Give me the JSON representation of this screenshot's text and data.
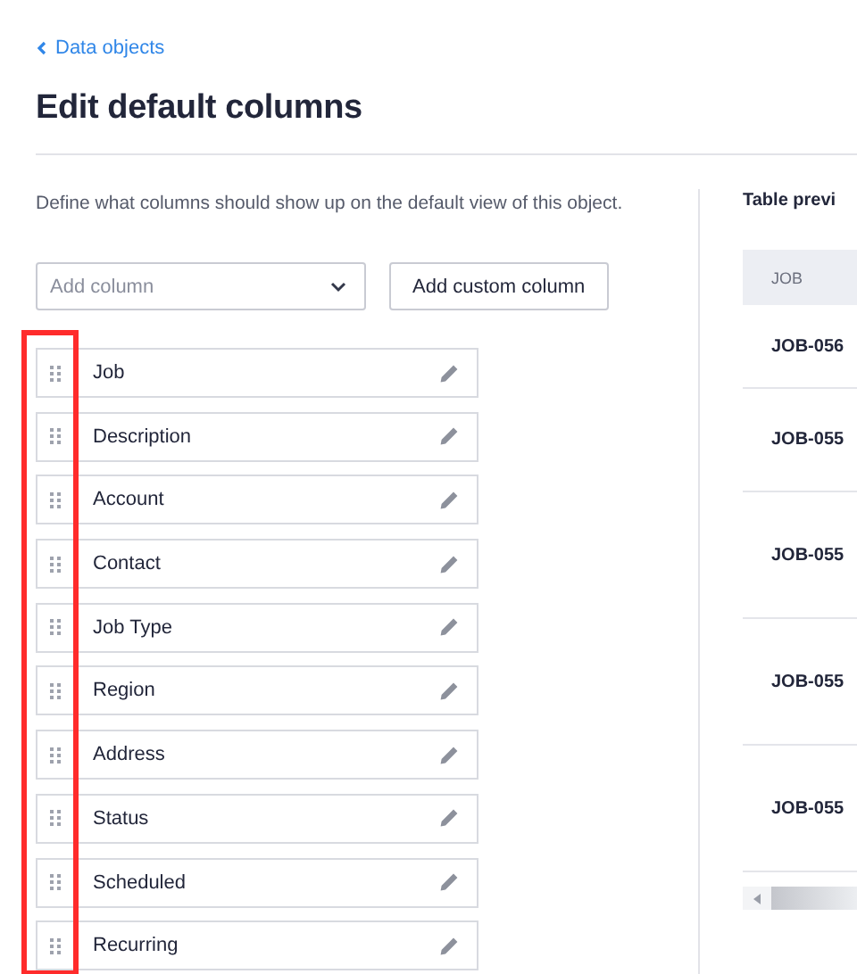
{
  "breadcrumb": {
    "label": "Data objects"
  },
  "title": "Edit default columns",
  "description": "Define what columns should show up on the default view of this object.",
  "add_column": {
    "placeholder": "Add column"
  },
  "add_custom_button": "Add custom column",
  "columns": [
    {
      "label": "Job"
    },
    {
      "label": "Description"
    },
    {
      "label": "Account"
    },
    {
      "label": "Contact"
    },
    {
      "label": "Job Type"
    },
    {
      "label": "Region"
    },
    {
      "label": "Address"
    },
    {
      "label": "Status"
    },
    {
      "label": "Scheduled"
    },
    {
      "label": "Recurring"
    }
  ],
  "preview": {
    "title": "Table previ",
    "header": "JOB",
    "rows": [
      {
        "job": "JOB-056"
      },
      {
        "job": "JOB-055"
      },
      {
        "job": "JOB-055"
      },
      {
        "job": "JOB-055"
      },
      {
        "job": "JOB-055"
      }
    ]
  }
}
